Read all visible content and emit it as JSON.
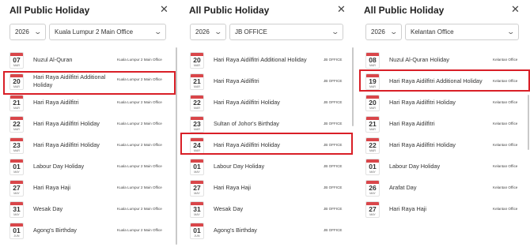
{
  "panels": [
    {
      "title": "All Public Holiday",
      "close_icon": "close-icon",
      "year": "2026",
      "office": "Kuala Lumpur 2 Main Office",
      "holidays": [
        {
          "day": "07",
          "month": "MAR",
          "name": "Nuzul Al-Quran",
          "location": "Kuala Lumpur 2 Main Office"
        },
        {
          "day": "20",
          "month": "MAR",
          "name": "Hari Raya Aidilfitri Additional Holiday",
          "location": "Kuala Lumpur 2 Main Office",
          "highlighted": true
        },
        {
          "day": "21",
          "month": "MAR",
          "name": "Hari Raya Aidilfitri",
          "location": "Kuala Lumpur 2 Main Office"
        },
        {
          "day": "22",
          "month": "MAR",
          "name": "Hari Raya Aidilfitri Holiday",
          "location": "Kuala Lumpur 2 Main Office"
        },
        {
          "day": "23",
          "month": "MAR",
          "name": "Hari Raya Aidilfitri Holiday",
          "location": "Kuala Lumpur 2 Main Office"
        },
        {
          "day": "01",
          "month": "MAY",
          "name": "Labour Day Holiday",
          "location": "Kuala Lumpur 2 Main Office"
        },
        {
          "day": "27",
          "month": "MAY",
          "name": "Hari Raya Haji",
          "location": "Kuala Lumpur 2 Main Office"
        },
        {
          "day": "31",
          "month": "MAY",
          "name": "Wesak Day",
          "location": "Kuala Lumpur 2 Main Office"
        },
        {
          "day": "01",
          "month": "JUN",
          "name": "Agong's Birthday",
          "location": "Kuala Lumpur 2 Main Office"
        }
      ]
    },
    {
      "title": "All Public Holiday",
      "close_icon": "close-icon",
      "year": "2026",
      "office": "JB OFFICE",
      "holidays": [
        {
          "day": "20",
          "month": "MAR",
          "name": "Hari Raya Aidilfitri Additional Holiday",
          "location": "JB OFFICE"
        },
        {
          "day": "21",
          "month": "MAR",
          "name": "Hari Raya Aidilfitri",
          "location": "JB OFFICE"
        },
        {
          "day": "22",
          "month": "MAR",
          "name": "Hari Raya Aidilfitri Holiday",
          "location": "JB OFFICE"
        },
        {
          "day": "23",
          "month": "MAR",
          "name": "Sultan of Johor's Birthday",
          "location": "JB OFFICE"
        },
        {
          "day": "24",
          "month": "MAR",
          "name": "Hari Raya Aidilfitri Holiday",
          "location": "JB OFFICE",
          "highlighted": true
        },
        {
          "day": "01",
          "month": "MAY",
          "name": "Labour Day Holiday",
          "location": "JB OFFICE"
        },
        {
          "day": "27",
          "month": "MAY",
          "name": "Hari Raya Haji",
          "location": "JB OFFICE"
        },
        {
          "day": "31",
          "month": "MAY",
          "name": "Wesak Day",
          "location": "JB OFFICE"
        },
        {
          "day": "01",
          "month": "JUN",
          "name": "Agong's Birthday",
          "location": "JB OFFICE"
        }
      ]
    },
    {
      "title": "All Public Holiday",
      "close_icon": "close-icon",
      "year": "2026",
      "office": "Kelantan Office",
      "holidays": [
        {
          "day": "08",
          "month": "MAR",
          "name": "Nuzul Al-Quran Holiday",
          "location": "Kelantan Office"
        },
        {
          "day": "19",
          "month": "MAR",
          "name": "Hari Raya Aidilfitri Additional Holiday",
          "location": "Kelantan Office",
          "highlighted": true
        },
        {
          "day": "20",
          "month": "MAR",
          "name": "Hari Raya Aidilfitri Holiday",
          "location": "Kelantan Office"
        },
        {
          "day": "21",
          "month": "MAR",
          "name": "Hari Raya Aidilfitri",
          "location": "Kelantan Office"
        },
        {
          "day": "22",
          "month": "MAR",
          "name": "Hari Raya Aidilfitri Holiday",
          "location": "Kelantan Office"
        },
        {
          "day": "01",
          "month": "MAY",
          "name": "Labour Day Holiday",
          "location": "Kelantan Office"
        },
        {
          "day": "26",
          "month": "MAY",
          "name": "Arafat Day",
          "location": "Kelantan Office"
        },
        {
          "day": "27",
          "month": "MAY",
          "name": "Hari Raya Haji",
          "location": "Kelantan Office"
        }
      ]
    }
  ],
  "colors": {
    "highlight": "#d91f27",
    "calendar_top": "#d9464a"
  }
}
